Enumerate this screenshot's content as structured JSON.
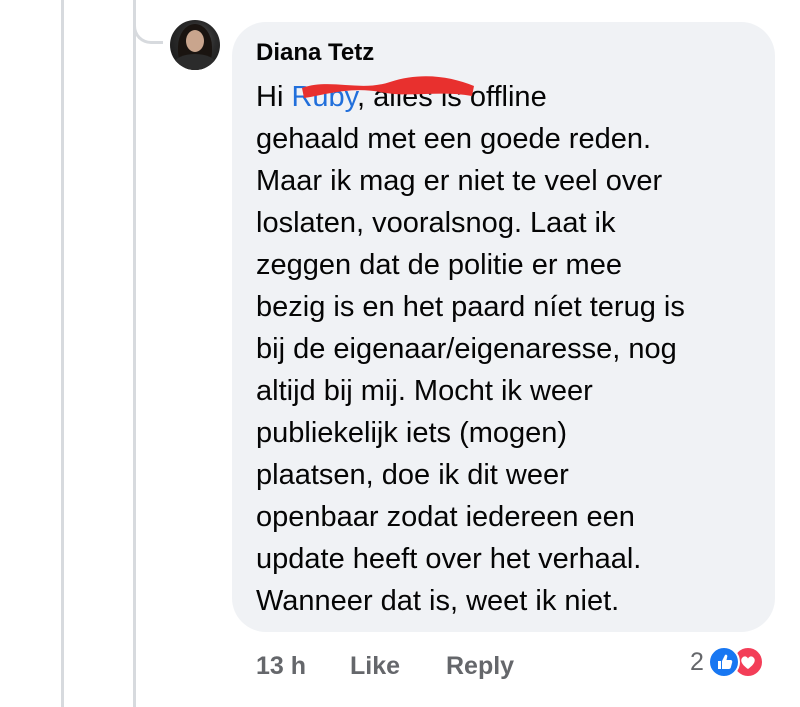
{
  "comment": {
    "author": "Diana Tetz",
    "greeting": "Hi ",
    "mention": "Ruby",
    "body": ", alles is offline\ngehaald met een goede reden.\nMaar ik mag er niet te veel over\nloslaten, vooralsnog. Laat ik\nzeggen dat de politie er mee\nbezig is en het paard níet terug is\nbij de eigenaar/eigenaresse, nog\naltijd bij mij. Mocht ik weer\npubliekelijk iets (mogen)\nplaatsen, doe ik dit weer\nopenbaar zodat iedereen een\nupdate heeft over het verhaal.\nWanneer dat is, weet ik niet."
  },
  "actions": {
    "time": "13 h",
    "like_label": "Like",
    "reply_label": "Reply"
  },
  "reactions": {
    "count": "2",
    "types": [
      "like-icon",
      "love-icon"
    ]
  },
  "colors": {
    "bubble": "#f0f2f5",
    "mention": "#216fdb",
    "like": "#1877f2",
    "love": "#f33e58",
    "redaction": "#e8302e",
    "muted_text": "#65676b"
  }
}
